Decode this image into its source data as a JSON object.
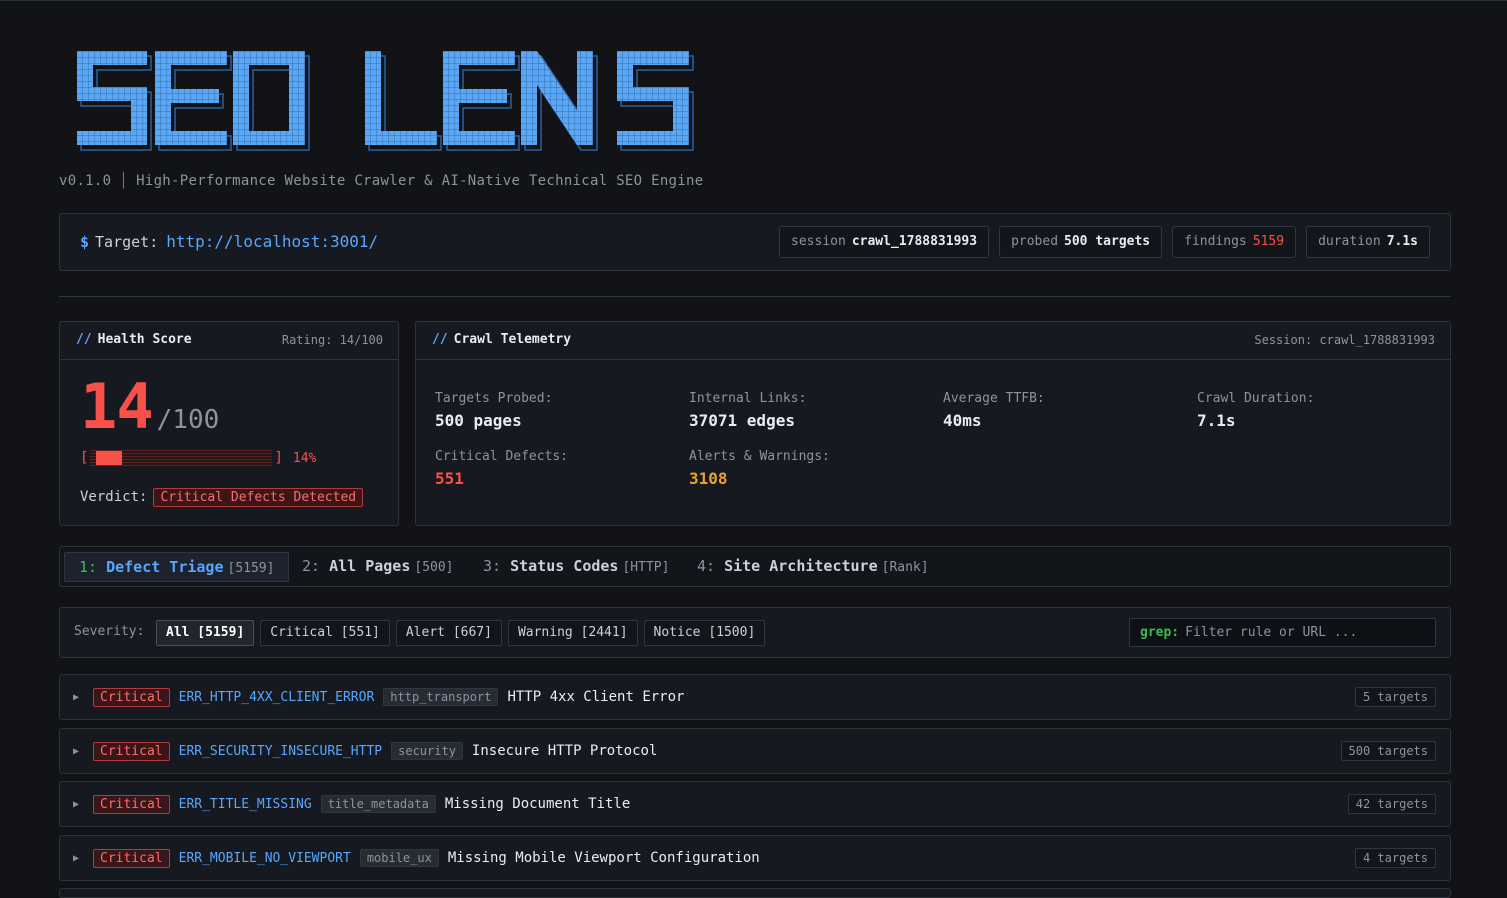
{
  "app": {
    "logo_text": "SEO LENS",
    "version": "v0.1.0",
    "tagline": "High-Performance Website Crawler & AI-Native Technical SEO Engine"
  },
  "target": {
    "label": "Target:",
    "prompt": "$",
    "url": "http://localhost:3001/",
    "session_key": "session",
    "session_value": "crawl_1788831993",
    "probed_key": "probed",
    "probed_value": "500 targets",
    "findings_key": "findings",
    "findings_value": "5159",
    "duration_key": "duration",
    "duration_value": "7.1s"
  },
  "health": {
    "title": "Health Score",
    "rating": "Rating: 14/100",
    "score": "14",
    "max": "/100",
    "progress": 0.14,
    "percent_label": "14%",
    "verdict_label": "Verdict:",
    "verdict": "Critical Defects Detected"
  },
  "telemetry": {
    "title": "Crawl Telemetry",
    "session": "Session: crawl_1788831993",
    "stats": [
      {
        "label": "Targets Probed:",
        "value": "500 pages"
      },
      {
        "label": "Internal Links:",
        "value": "37071 edges"
      },
      {
        "label": "Average TTFB:",
        "value": "40ms"
      },
      {
        "label": "Crawl Duration:",
        "value": "7.1s"
      },
      {
        "label": "Critical Defects:",
        "value": "551"
      },
      {
        "label": "Alerts & Warnings:",
        "value": "3108"
      }
    ]
  },
  "tabs": [
    {
      "num": "1:",
      "label": "Defect Triage",
      "count": "[5159]"
    },
    {
      "num": "2:",
      "label": "All Pages",
      "count": "[500]"
    },
    {
      "num": "3:",
      "label": "Status Codes",
      "count": "[HTTP]"
    },
    {
      "num": "4:",
      "label": "Site Architecture",
      "count": "[Rank]"
    }
  ],
  "filter": {
    "severity_label": "Severity:",
    "chips": [
      "All [5159]",
      "Critical [551]",
      "Alert [667]",
      "Warning [2441]",
      "Notice [1500]"
    ],
    "grep_label": "grep:",
    "grep_placeholder": "Filter rule or URL ..."
  },
  "findings": [
    {
      "severity": "Critical",
      "code": "ERR_HTTP_4XX_CLIENT_ERROR",
      "category": "http_transport",
      "title": "HTTP 4xx Client Error",
      "targets": "5 targets"
    },
    {
      "severity": "Critical",
      "code": "ERR_SECURITY_INSECURE_HTTP",
      "category": "security",
      "title": "Insecure HTTP Protocol",
      "targets": "500 targets"
    },
    {
      "severity": "Critical",
      "code": "ERR_TITLE_MISSING",
      "category": "title_metadata",
      "title": "Missing Document Title",
      "targets": "42 targets"
    },
    {
      "severity": "Critical",
      "code": "ERR_MOBILE_NO_VIEWPORT",
      "category": "mobile_ux",
      "title": "Missing Mobile Viewport Configuration",
      "targets": "4 targets"
    }
  ],
  "colors": {
    "accent": "#58a6ff",
    "critical": "#f85149",
    "warning": "#e3a13c",
    "success": "#3fb950",
    "background": "#111317"
  }
}
